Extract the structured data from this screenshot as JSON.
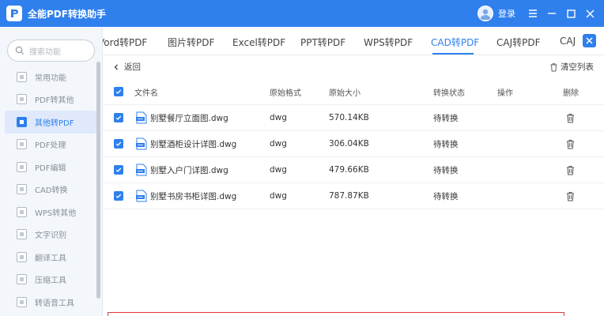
{
  "app": {
    "title": "全能PDF转换助手",
    "login_label": "登录"
  },
  "sidebar": {
    "search_placeholder": "搜索功能",
    "items": [
      {
        "label": "常用功能",
        "icon": "home-icon",
        "active": false
      },
      {
        "label": "PDF转其他",
        "icon": "pdf-icon",
        "active": false
      },
      {
        "label": "其他转PDF",
        "icon": "convert-icon",
        "active": true
      },
      {
        "label": "PDF处理",
        "icon": "process-icon",
        "active": false
      },
      {
        "label": "PDF编辑",
        "icon": "edit-icon",
        "active": false
      },
      {
        "label": "CAD转换",
        "icon": "cad-icon",
        "active": false
      },
      {
        "label": "WPS转其他",
        "icon": "wps-icon",
        "active": false
      },
      {
        "label": "文字识别",
        "icon": "ocr-icon",
        "active": false
      },
      {
        "label": "翻译工具",
        "icon": "translate-icon",
        "active": false
      },
      {
        "label": "压缩工具",
        "icon": "compress-icon",
        "active": false
      },
      {
        "label": "转语音工具",
        "icon": "speech-icon",
        "active": false
      }
    ]
  },
  "tabs": [
    {
      "label": "Word转PDF",
      "shown": "Vord转PDF",
      "active": false
    },
    {
      "label": "图片转PDF",
      "active": false
    },
    {
      "label": "Excel转PDF",
      "active": false
    },
    {
      "label": "PPT转PDF",
      "active": false
    },
    {
      "label": "WPS转PDF",
      "active": false
    },
    {
      "label": "CAD转PDF",
      "active": true
    },
    {
      "label": "CAJ转PDF",
      "active": false
    },
    {
      "label": "CAJ",
      "active": false
    }
  ],
  "toolbar": {
    "back_label": "返回",
    "clear_label": "清空列表"
  },
  "table": {
    "headers": {
      "filename": "文件名",
      "format": "原始格式",
      "size": "原始大小",
      "status": "转换状态",
      "action": "操作",
      "delete": "删除"
    },
    "rows": [
      {
        "name": "别墅餐厅立面图.dwg",
        "format": "dwg",
        "size": "570.14KB",
        "status": "待转换"
      },
      {
        "name": "别墅酒柜设计详图.dwg",
        "format": "dwg",
        "size": "306.04KB",
        "status": "待转换"
      },
      {
        "name": "别墅入户门详图.dwg",
        "format": "dwg",
        "size": "479.66KB",
        "status": "待转换"
      },
      {
        "name": "别墅书房书柜详图.dwg",
        "format": "dwg",
        "size": "787.87KB",
        "status": "待转换"
      }
    ]
  },
  "colors": {
    "brand": "#2f80ed",
    "highlight_outline": "#e03b3b"
  }
}
